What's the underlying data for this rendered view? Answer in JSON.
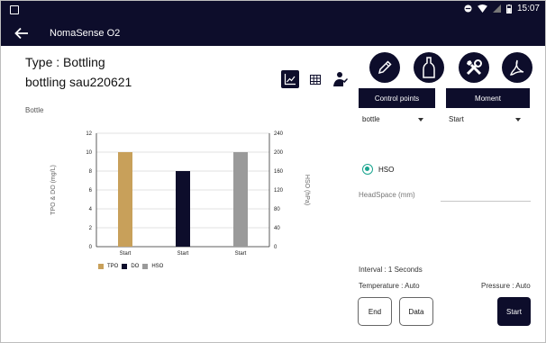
{
  "status_bar": {
    "time": "15:07"
  },
  "app_bar": {
    "title": "NomaSense O2"
  },
  "header": {
    "type_text": "Type : Bottling",
    "name_text": "bottling sau220621",
    "section_label": "Bottle"
  },
  "buttons": {
    "control_points": "Control points",
    "moment": "Moment"
  },
  "selects": {
    "control_point_value": "bottle",
    "moment_value": "Start"
  },
  "measure": {
    "radio_label": "HSO",
    "headspace_label": "HeadSpace (mm)",
    "headspace_value": ""
  },
  "info": {
    "interval": "Interval : 1 Seconds",
    "temperature": "Temperature : Auto",
    "pressure": "Pressure : Auto"
  },
  "actions": {
    "end": "End",
    "data": "Data",
    "start": "Start"
  },
  "colors": {
    "tpo": "#c8a05a",
    "do": "#0d0d2b",
    "hso": "#9a9a9a",
    "accent": "#1aa58f",
    "primary": "#0d0d2b"
  },
  "chart_data": {
    "type": "bar",
    "categories": [
      "Start",
      "Start",
      "Start"
    ],
    "series": [
      {
        "name": "TPO",
        "values": [
          10,
          null,
          null
        ]
      },
      {
        "name": "DO",
        "values": [
          null,
          8,
          null
        ]
      },
      {
        "name": "HSO",
        "values": [
          null,
          null,
          10
        ]
      }
    ],
    "ylabel": "TPO & DO (mg/L)",
    "y2label": "HSO (hPa)",
    "ylim": [
      0,
      12
    ],
    "y2lim": [
      0,
      240
    ],
    "yticks": [
      "0",
      "2",
      "4",
      "6",
      "8",
      "10",
      "12"
    ],
    "y2ticks": [
      "0",
      "40",
      "80",
      "120",
      "160",
      "200",
      "240"
    ],
    "legend": [
      "TPO",
      "DO",
      "HSO"
    ],
    "legend_position": "bottom-left",
    "grid": "horizontal"
  }
}
